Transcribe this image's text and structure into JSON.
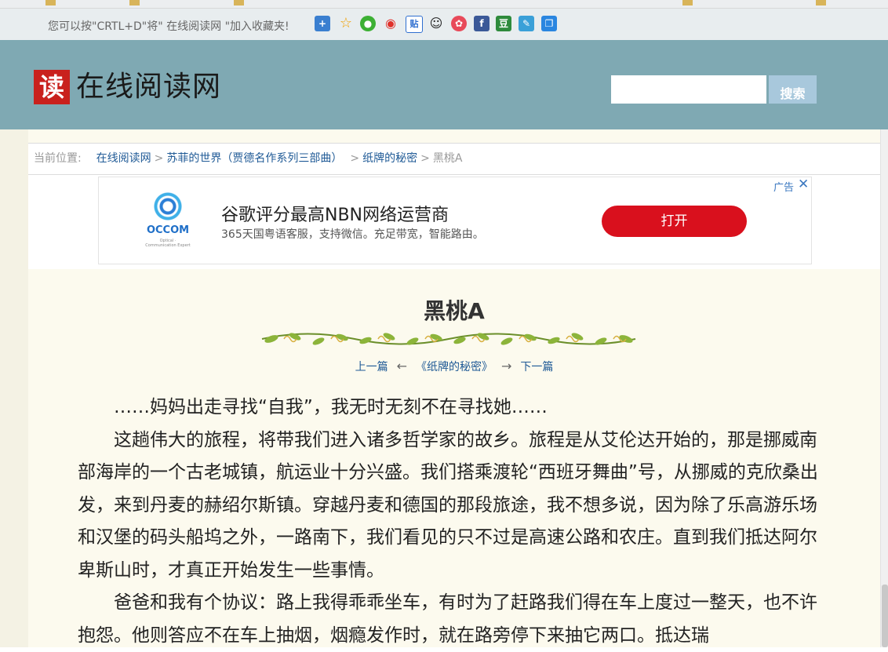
{
  "bookmarks_bar": {
    "items": [
      "",
      "",
      "",
      "",
      ""
    ]
  },
  "topbar": {
    "message": "您可以按\"CRTL+D\"将\" 在线阅读网 \"加入收藏夹!",
    "share_icons": [
      "add-icon",
      "star-icon",
      "wechat-icon",
      "weibo-icon",
      "tieba-icon",
      "qq-icon",
      "flower-icon",
      "facebook-icon",
      "douban-icon",
      "pen-icon",
      "copy-icon"
    ]
  },
  "header": {
    "logo_char": "读",
    "logo_text": "在线阅读网",
    "search_placeholder": "",
    "search_button": "搜索"
  },
  "breadcrumb": {
    "prefix": "当前位置:",
    "items": [
      "在线阅读网",
      "苏菲的世界（贾德名作系列三部曲）",
      "纸牌的秘密"
    ],
    "current": "黑桃A"
  },
  "ad": {
    "brand": "OCCOM",
    "brand_sub": "Optical · Communication Expert",
    "title": "谷歌评分最高NBN网络运营商",
    "subtitle": "365天国粤语客服，支持微信。充足带宽，智能路由。",
    "cta": "打开",
    "label": "广告",
    "close": "✕"
  },
  "article": {
    "title": "黑桃A",
    "prev": "上一篇",
    "book": "《纸牌的秘密》",
    "next": "下一篇",
    "left_arrow": "←",
    "right_arrow": "→",
    "paragraphs": [
      "……妈妈出走寻找“自我”，我无时无刻不在寻找她……",
      "这趟伟大的旅程，将带我们进入诸多哲学家的故乡。旅程是从艾伦达开始的，那是挪威南部海岸的一个古老城镇，航运业十分兴盛。我们搭乘渡轮“西班牙舞曲”号，从挪威的克欣桑出发，来到丹麦的赫绍尔斯镇。穿越丹麦和德国的那段旅途，我不想多说，因为除了乐高游乐场和汉堡的码头船坞之外，一路南下，我们看见的只不过是高速公路和农庄。直到我们抵达阿尔卑斯山时，才真正开始发生一些事情。",
      "爸爸和我有个协议：路上我得乖乖坐车，有时为了赶路我们得在车上度过一整天，也不许抱怨。他则答应不在车上抽烟，烟瘾发作时，就在路旁停下来抽它两口。抵达瑞"
    ]
  },
  "colors": {
    "header_bg": "#7fa9b3",
    "page_bg": "#fcfaee",
    "link": "#1f5a96",
    "ad_button": "#d9101d",
    "logo_red": "#c9211d"
  }
}
